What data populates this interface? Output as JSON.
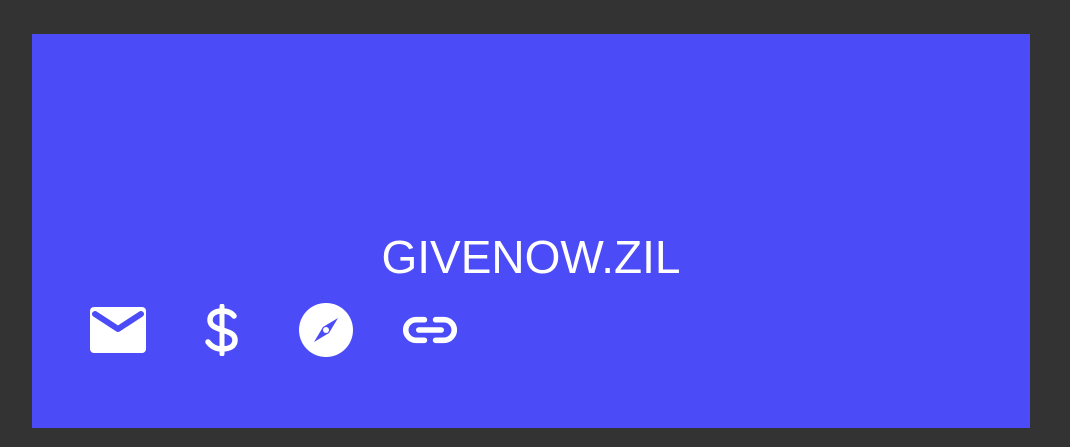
{
  "card": {
    "title": "GIVENOW.ZIL",
    "background_color": "#4b4bf7",
    "text_color": "#ffffff"
  },
  "actions": [
    {
      "icon": "envelope-icon"
    },
    {
      "icon": "dollar-icon"
    },
    {
      "icon": "compass-icon"
    },
    {
      "icon": "link-icon"
    }
  ]
}
